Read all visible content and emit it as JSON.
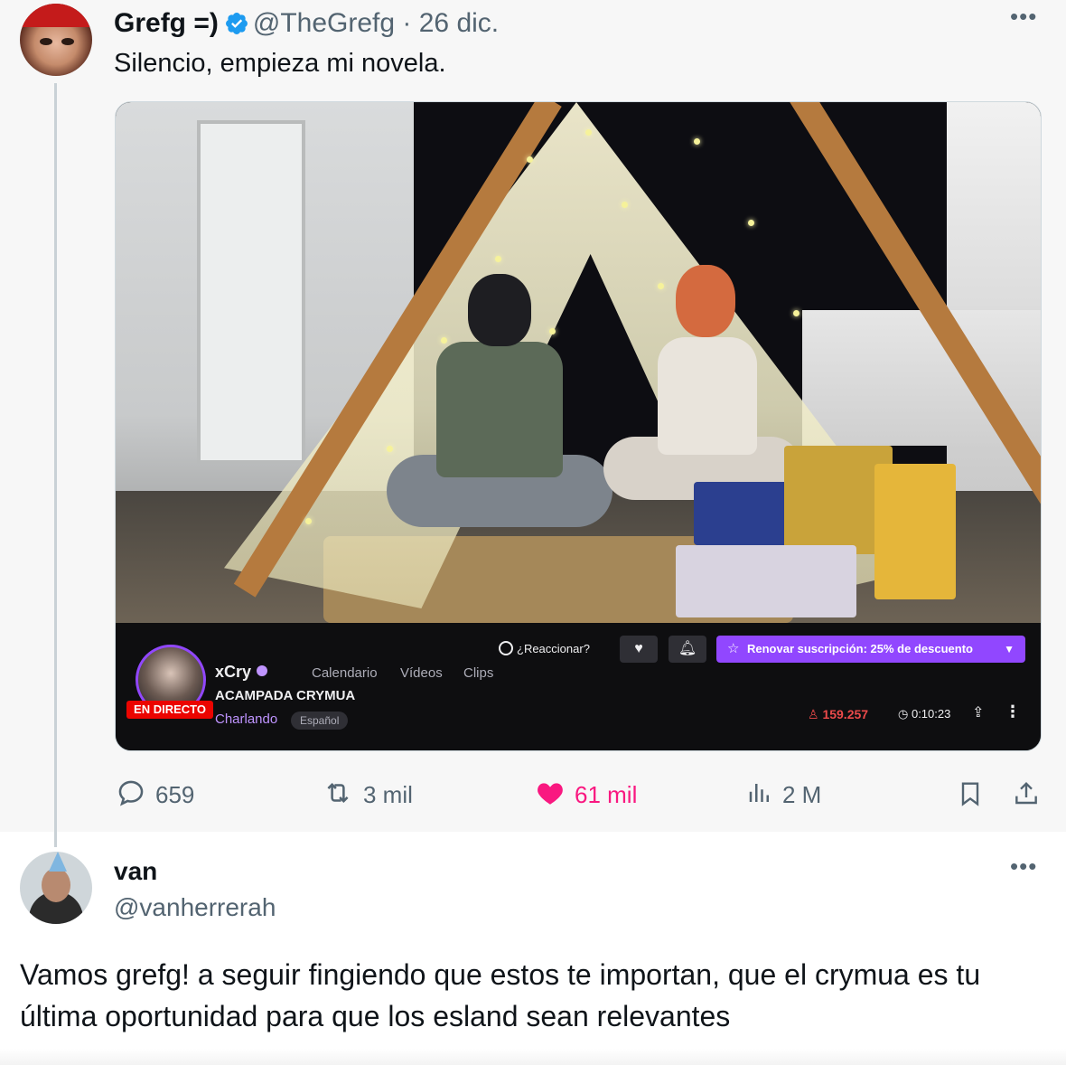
{
  "tweet1": {
    "display_name": "Grefg =)",
    "handle": "@TheGrefg",
    "separator": "·",
    "date": "26 dic.",
    "more_icon": "more-horizontal-icon",
    "text": "Silencio, empieza mi novela.",
    "media": {
      "stream": {
        "live_badge": "EN DIRECTO",
        "channel_name": "xCry",
        "nav": [
          "Calendario",
          "Vídeos",
          "Clips"
        ],
        "title": "ACAMPADA CRYMUA",
        "category": "Charlando",
        "tag": "Español",
        "react_label": "¿Reaccionar?",
        "subscribe_label": "Renovar suscripción: 25% de descuento",
        "viewers": "159.257",
        "uptime": "0:10:23",
        "accent_color": "#9147ff",
        "live_color": "#eb0400"
      }
    },
    "actions": {
      "replies": "659",
      "retweets": "3 mil",
      "likes": "61 mil",
      "views": "2 M"
    },
    "like_color": "#f91880"
  },
  "tweet2": {
    "display_name": "van",
    "handle": "@vanherrerah",
    "text": "Vamos grefg! a seguir fingiendo que estos te importan, que el crymua es tu última oportunidad para que los esland sean relevantes"
  }
}
